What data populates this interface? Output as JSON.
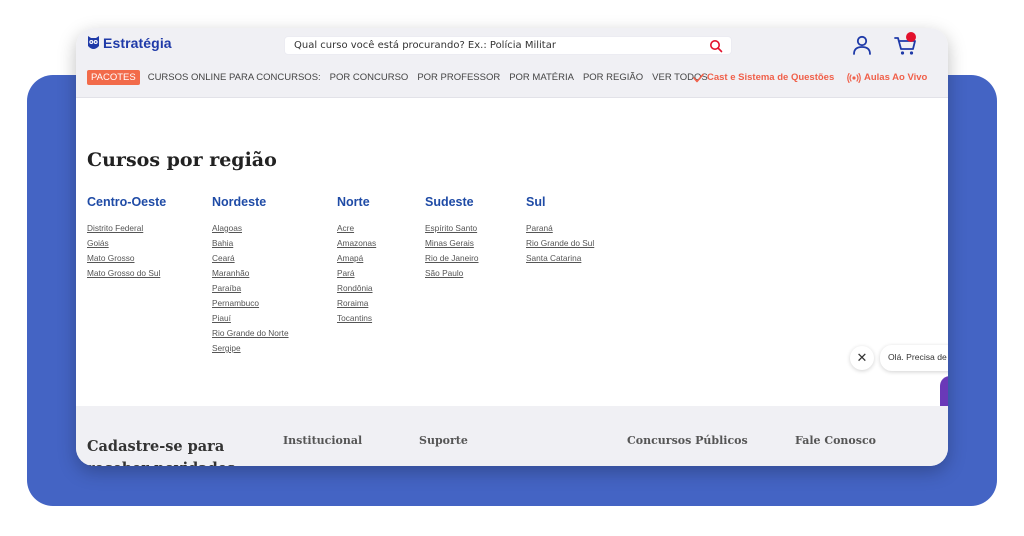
{
  "header": {
    "logo_text": "Estratégia",
    "search_placeholder": "Qual curso você está procurando? Ex.: Polícia Militar"
  },
  "nav": {
    "pacotes": "PACOTES",
    "items": [
      "CURSOS ONLINE PARA CONCURSOS:",
      "POR CONCURSO",
      "POR PROFESSOR",
      "POR MATÉRIA",
      "POR REGIÃO",
      "VER TODOS"
    ],
    "cast": "Cast e Sistema de Questões",
    "aulas": "Aulas Ao Vivo"
  },
  "main": {
    "title": "Cursos por região",
    "regions": [
      {
        "name": "Centro-Oeste",
        "states": [
          "Distrito Federal",
          "Goiás",
          "Mato Grosso",
          "Mato Grosso do Sul"
        ]
      },
      {
        "name": "Nordeste",
        "states": [
          "Alagoas",
          "Bahia",
          "Ceará",
          "Maranhão",
          "Paraíba",
          "Pernambuco",
          "Piauí",
          "Rio Grande do Norte",
          "Sergipe"
        ]
      },
      {
        "name": "Norte",
        "states": [
          "Acre",
          "Amazonas",
          "Amapá",
          "Pará",
          "Rondônia",
          "Roraima",
          "Tocantins"
        ]
      },
      {
        "name": "Sudeste",
        "states": [
          "Espírito Santo",
          "Minas Gerais",
          "Rio de Janeiro",
          "São Paulo"
        ]
      },
      {
        "name": "Sul",
        "states": [
          "Paraná",
          "Rio Grande do Sul",
          "Santa Catarina"
        ]
      }
    ]
  },
  "chat": {
    "message": "Olá. Precisa de"
  },
  "footer": {
    "signup": "Cadastre-se para receber novidades",
    "institucional": "Institucional",
    "suporte": "Suporte",
    "concursos": "Concursos Públicos",
    "fale": "Fale Conosco"
  },
  "colors": {
    "brand": "#1f3aa8",
    "accent": "#f26b4a",
    "region_title": "#1f4ba6",
    "background_panel": "#4464c4"
  }
}
